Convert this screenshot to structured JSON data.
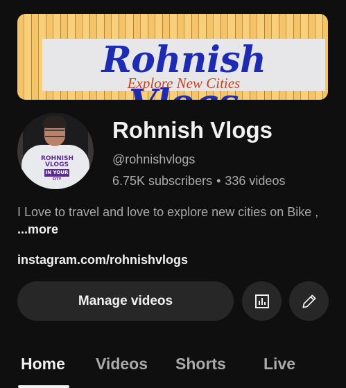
{
  "banner": {
    "title": "Rohnish Vlogs",
    "subtitle": "Explore New Cities"
  },
  "avatar": {
    "logo_line1": "ROHNISH",
    "logo_line2": "VLOGS",
    "logo_ribbon": "IN YOUR",
    "logo_line3": "CITY"
  },
  "channel": {
    "name": "Rohnish Vlogs",
    "handle": "@rohnishvlogs",
    "subscribers": "6.75K subscribers",
    "separator": "•",
    "videos": "336 videos",
    "description": "I Love to travel and love to explore new cities on Bike ,",
    "more_label": "...more",
    "link": "instagram.com/rohnishvlogs"
  },
  "actions": {
    "manage_videos": "Manage videos",
    "analytics_icon": "analytics-icon",
    "edit_icon": "pencil-icon"
  },
  "tabs": [
    {
      "label": "Home",
      "active": true
    },
    {
      "label": "Videos",
      "active": false
    },
    {
      "label": "Shorts",
      "active": false
    },
    {
      "label": "Live",
      "active": false
    }
  ],
  "colors": {
    "background": "#0f0f0f",
    "primary_text": "#f1f1f1",
    "secondary_text": "#aaaaaa",
    "button_bg": "#272727",
    "banner_title": "#1d2bb3",
    "banner_subtitle": "#c7431d"
  }
}
